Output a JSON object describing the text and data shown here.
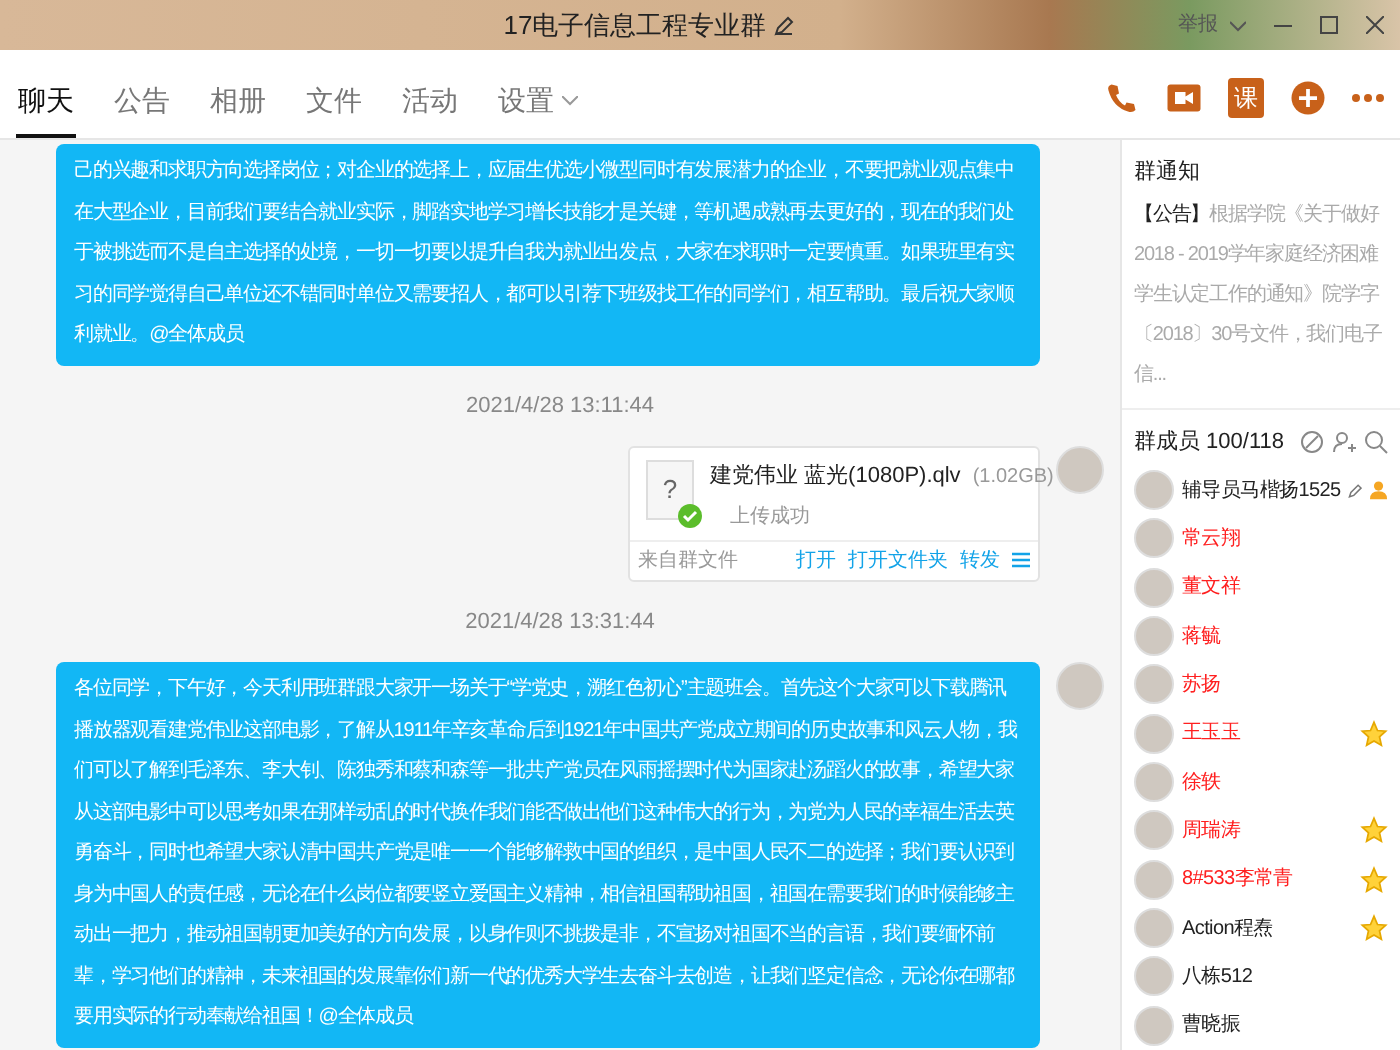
{
  "window": {
    "title": "17电子信息工程专业群",
    "report": "举报"
  },
  "toolbar": {
    "class_label": "课"
  },
  "tabs": [
    {
      "label": "聊天",
      "selected": true
    },
    {
      "label": "公告",
      "selected": false
    },
    {
      "label": "相册",
      "selected": false
    },
    {
      "label": "文件",
      "selected": false
    },
    {
      "label": "活动",
      "selected": false
    },
    {
      "label": "设置",
      "selected": false,
      "dropdown": true
    }
  ],
  "messages": [
    {
      "kind": "text",
      "text": "己的兴趣和求职方向选择岗位；对企业的选择上，应届生优选小微型同时有发展潜力的企业，不要把就业观点集中在大型企业，目前我们要结合就业实际，脚踏实地学习增长技能才是关键，等机遇成熟再去更好的，现在的我们处于被挑选而不是自主选择的处境，一切一切要以提升自我为就业出发点，大家在求职时一定要慎重。如果班里有实习的同学觉得自己单位还不错同时单位又需要招人，都可以引荐下班级找工作的同学们，相互帮助。最后祝大家顺利就业。@全体成员"
    },
    {
      "kind": "time",
      "text": "2021/4/28 13:11:44"
    },
    {
      "kind": "file",
      "icon": "?",
      "name": "建党伟业 蓝光(1080P).qlv",
      "size": "(1.02GB)",
      "status": "上传成功",
      "source": "来自群文件",
      "actions": [
        "打开",
        "打开文件夹",
        "转发"
      ]
    },
    {
      "kind": "time",
      "text": "2021/4/28 13:31:44"
    },
    {
      "kind": "text",
      "text": "各位同学，下午好，今天利用班群跟大家开一场关于“学党史，溯红色初心”主题班会。首先这个大家可以下载腾讯播放器观看建党伟业这部电影，了解从1911年辛亥革命后到1921年中国共产党成立期间的历史故事和风云人物，我们可以了解到毛泽东、李大钊、陈独秀和蔡和森等一批共产党员在风雨摇摆时代为国家赴汤蹈火的故事，希望大家从这部电影中可以思考如果在那样动乱的时代换作我们能否做出他们这种伟大的行为，为党为人民的幸福生活去英勇奋斗，同时也希望大家认清中国共产党是唯一一个能够解救中国的组织，是中国人民不二的选择；我们要认识到身为中国人的责任感，无论在什么岗位都要竖立爱国主义精神，相信祖国帮助祖国，祖国在需要我们的时候能够主动出一把力，推动祖国朝更加美好的方向发展，以身作则不挑拨是非，不宣扬对祖国不当的言语，我们要缅怀前辈，学习他们的精神，未来祖国的发展靠你们新一代的优秀大学生去奋斗去创造，让我们坚定信念，无论你在哪都要用实际的行动奉献给祖国！@全体成员"
    }
  ],
  "notice": {
    "title": "群通知",
    "tag": "【公告】",
    "text": "根据学院《关于做好2018 - 2019学年家庭经济困难学生认定工作的通知》院学字〔2018〕30号文件，我们电子信..."
  },
  "members": {
    "title": "群成员 100/118",
    "list": [
      {
        "name": "辅导员马楷扬1525",
        "color": "#222222",
        "admin": true,
        "star": false
      },
      {
        "name": "常云翔",
        "color": "#ff2020",
        "admin": false,
        "star": false
      },
      {
        "name": "董文祥",
        "color": "#ff2020",
        "admin": false,
        "star": false
      },
      {
        "name": "蒋毓",
        "color": "#ff2020",
        "admin": false,
        "star": false
      },
      {
        "name": "苏扬",
        "color": "#ff2020",
        "admin": false,
        "star": false
      },
      {
        "name": "王玉玉",
        "color": "#ff2020",
        "admin": false,
        "star": true
      },
      {
        "name": "徐轶",
        "color": "#ff2020",
        "admin": false,
        "star": false
      },
      {
        "name": "周瑞涛",
        "color": "#ff2020",
        "admin": false,
        "star": true
      },
      {
        "name": "8#533李常青",
        "color": "#ff2020",
        "admin": false,
        "star": true
      },
      {
        "name": "Action程焘",
        "color": "#222222",
        "admin": false,
        "star": true
      },
      {
        "name": "八栋512",
        "color": "#222222",
        "admin": false,
        "star": false
      },
      {
        "name": "曹晓振",
        "color": "#222222",
        "admin": false,
        "star": false
      }
    ]
  }
}
